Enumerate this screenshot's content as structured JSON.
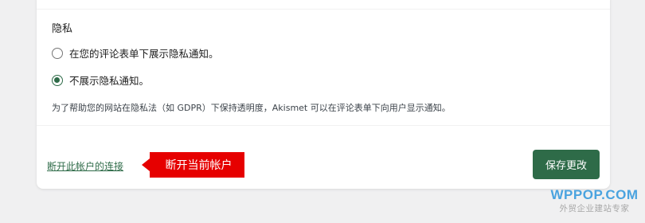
{
  "privacy": {
    "title": "隐私",
    "options": [
      {
        "label": "在您的评论表单下展示隐私通知。",
        "checked": false
      },
      {
        "label": "不展示隐私通知。",
        "checked": true
      }
    ],
    "help_text": "为了帮助您的网站在隐私法（如 GDPR）下保持透明度，Akismet 可以在评论表单下向用户显示通知。"
  },
  "footer": {
    "disconnect_label": "断开此帐户的连接",
    "callout_label": "断开当前帐户",
    "save_label": "保存更改"
  },
  "watermark": {
    "brand": "WPPOP.COM",
    "tagline": "外贸企业建站专家"
  },
  "colors": {
    "accent": "#2e6b48",
    "callout": "#e60000",
    "watermark": "#4aa3df"
  }
}
